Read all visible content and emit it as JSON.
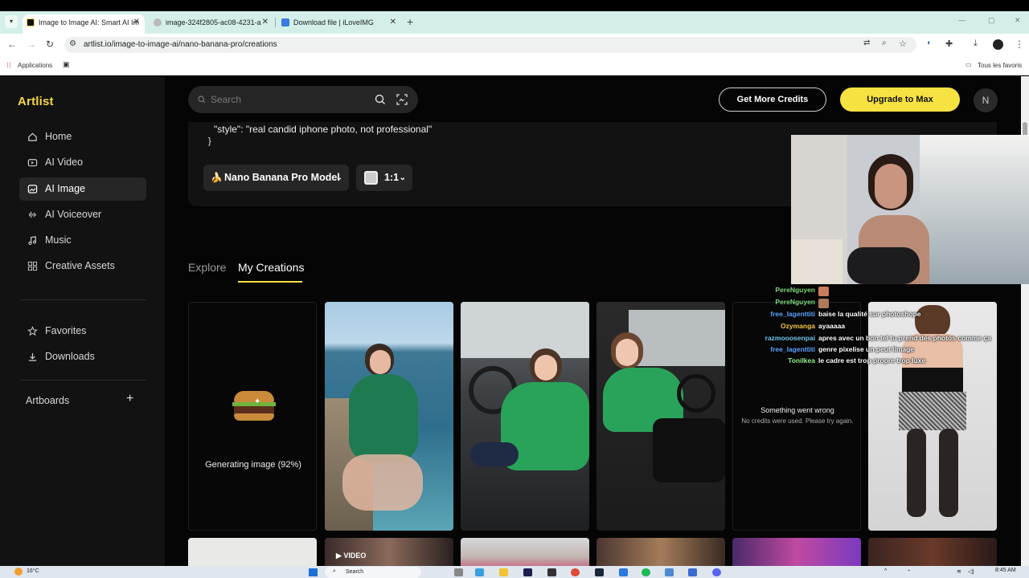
{
  "browser": {
    "tabs": [
      {
        "title": "Image to Image AI: Smart AI Im",
        "active": true
      },
      {
        "title": "image-324f2805-ac08-4231-a",
        "active": false
      },
      {
        "title": "Download file | iLoveIMG",
        "active": false
      }
    ],
    "url": "artlist.io/image-to-image-ai/nano-banana-pro/creations",
    "bookmarks": {
      "apps": "Applications",
      "all": "Tous les favoris"
    }
  },
  "app": {
    "logo": "Artlist",
    "search_placeholder": "Search",
    "get_credits": "Get More Credits",
    "upgrade": "Upgrade to Max",
    "avatar": "N"
  },
  "sidebar": {
    "items": [
      {
        "label": "Home",
        "icon": "home-icon"
      },
      {
        "label": "AI Video",
        "icon": "video-icon"
      },
      {
        "label": "AI Image",
        "icon": "image-icon",
        "selected": true
      },
      {
        "label": "AI Voiceover",
        "icon": "waveform-icon"
      },
      {
        "label": "Music",
        "icon": "music-note-icon"
      },
      {
        "label": "Creative Assets",
        "icon": "grid-icon"
      }
    ],
    "secondary": [
      {
        "label": "Favorites",
        "icon": "star-icon"
      },
      {
        "label": "Downloads",
        "icon": "download-icon"
      }
    ],
    "artboards": "Artboards"
  },
  "prompt": {
    "line": "\"style\": \"real candid iphone photo, not professional\"",
    "closing": "}",
    "model": "Nano Banana Pro Model",
    "ratio": "1:1"
  },
  "tabs": {
    "explore": "Explore",
    "creations": "My Creations"
  },
  "cards": {
    "generating": "Generating image (92%)",
    "error_title": "Something went wrong",
    "error_sub": "No credits were used. Please try again.",
    "video_badge": "VIDEO"
  },
  "chat": [
    {
      "user": "PereNguyen",
      "color": "#7bd67b",
      "msg": ""
    },
    {
      "user": "PereNguyen",
      "color": "#7bd67b",
      "msg": ""
    },
    {
      "user": "free_lagenttiti",
      "color": "#5aa0ff",
      "msg": "baise la qualité sur photoshope"
    },
    {
      "user": "Ozymanga",
      "color": "#f5c542",
      "msg": "ayaaaaa"
    },
    {
      "user": "razmooosenpai",
      "color": "#6ec6e8",
      "msg": "apres avec un bon tel tu prend des photos comme ça"
    },
    {
      "user": "free_lagenttiti",
      "color": "#5aa0ff",
      "msg": "genre pixelise un peut limage"
    },
    {
      "user": "Tonilkea",
      "color": "#8ef08e",
      "msg": "le cadre est trop propre trop luxe"
    }
  ],
  "taskbar": {
    "temp": "16°C",
    "search": "Search",
    "time": "8:45 AM"
  }
}
